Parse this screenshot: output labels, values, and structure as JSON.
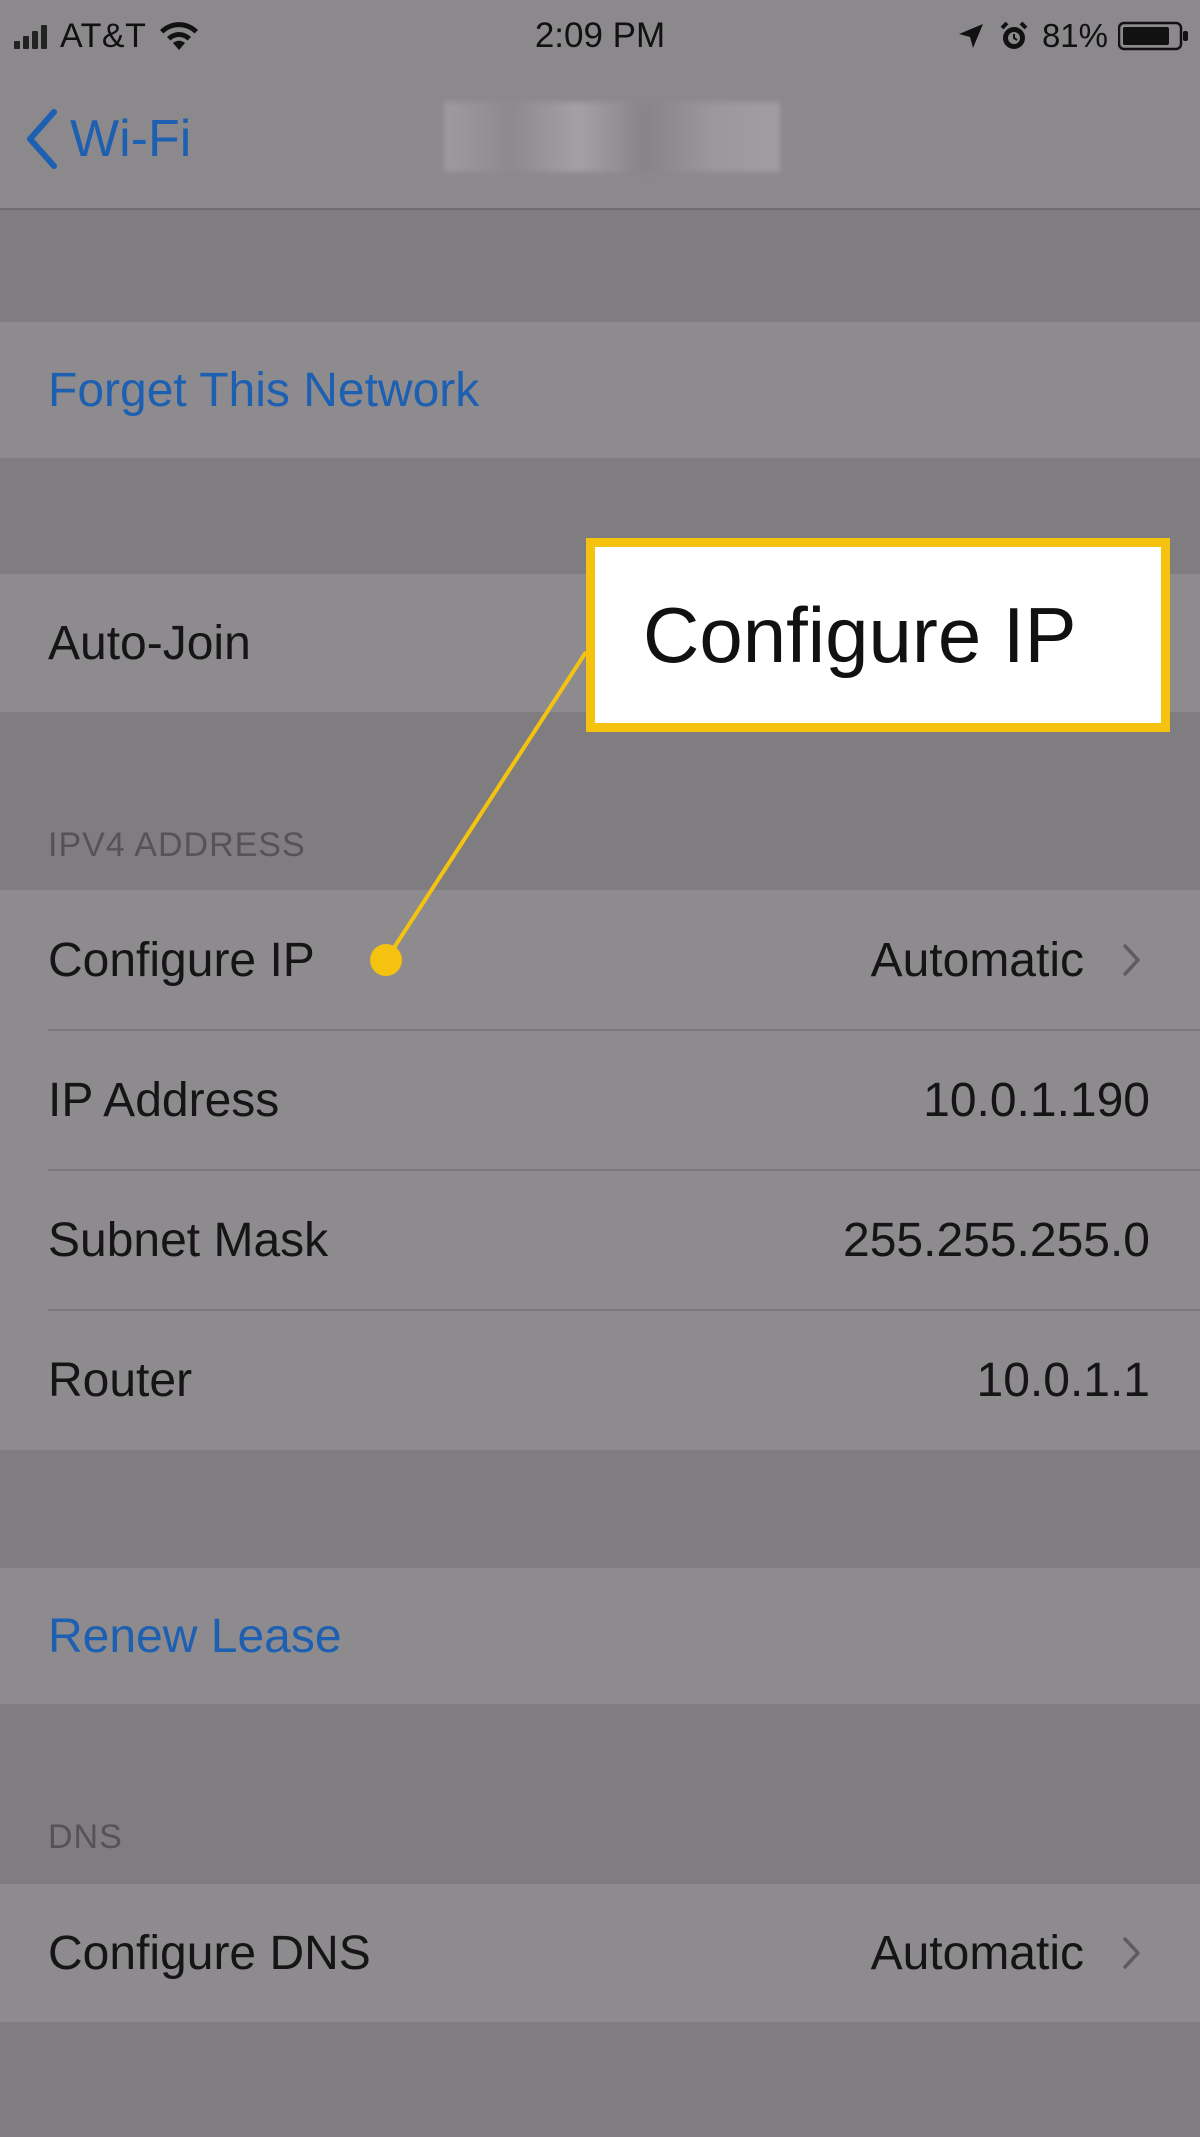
{
  "status_bar": {
    "carrier": "AT&T",
    "time": "2:09 PM",
    "battery": "81%"
  },
  "nav": {
    "back_label": "Wi-Fi"
  },
  "forget_network": {
    "label": "Forget This Network"
  },
  "auto_join": {
    "label": "Auto-Join"
  },
  "ipv4": {
    "header": "IPV4 ADDRESS",
    "rows": [
      {
        "label": "Configure IP",
        "value": "Automatic"
      },
      {
        "label": "IP Address",
        "value": "10.0.1.190"
      },
      {
        "label": "Subnet Mask",
        "value": "255.255.255.0"
      },
      {
        "label": "Router",
        "value": "10.0.1.1"
      }
    ]
  },
  "renew_lease": {
    "label": "Renew Lease"
  },
  "dns": {
    "header": "DNS",
    "configure_label": "Configure DNS",
    "configure_value": "Automatic"
  },
  "callout": {
    "text": "Configure IP"
  },
  "colors": {
    "link_blue": "#1d5fb0",
    "callout_yellow": "#f4c20f"
  },
  "icons": {
    "back": "chevron-left-icon",
    "disclosure": "chevron-right-icon",
    "wifi": "wifi-icon",
    "location": "location-arrow-icon",
    "alarm": "alarm-clock-icon",
    "battery": "battery-icon"
  }
}
